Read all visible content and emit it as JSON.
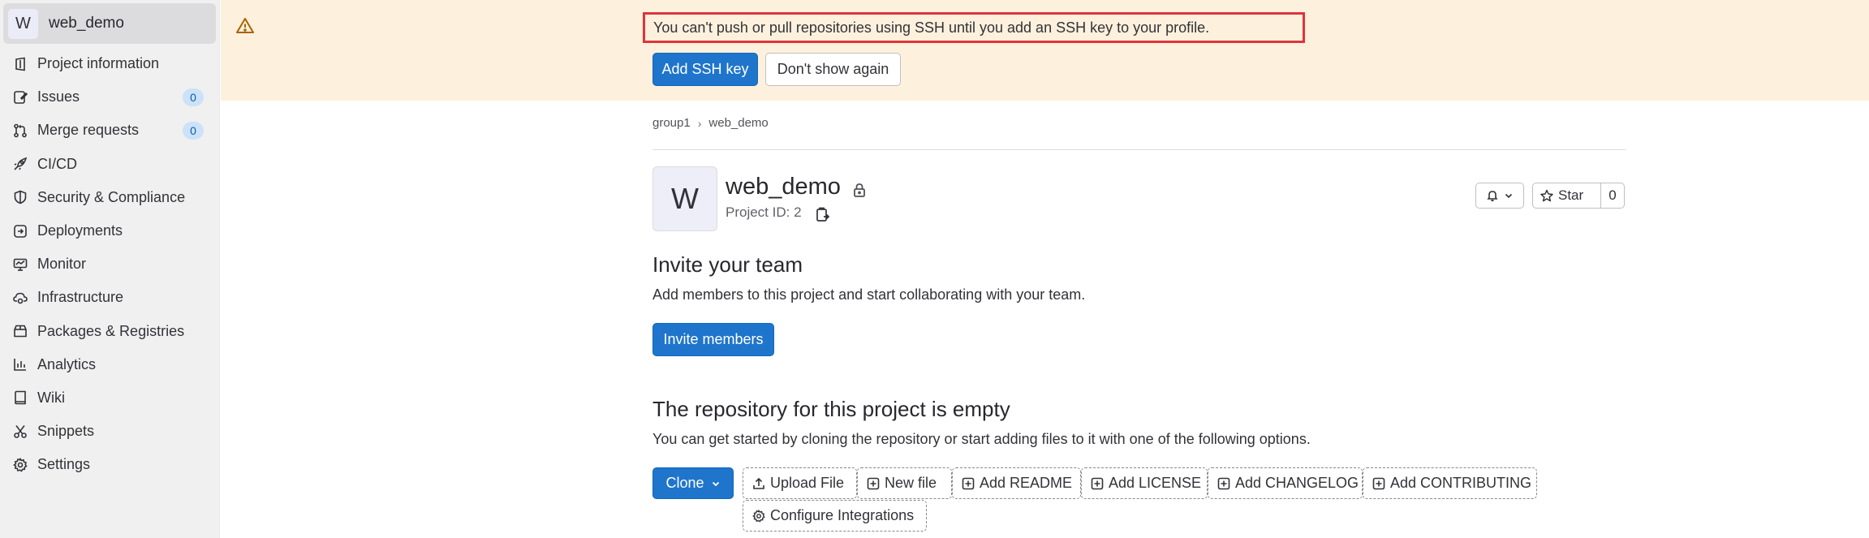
{
  "sidebar": {
    "project_avatar": "W",
    "project_name": "web_demo",
    "items": [
      {
        "label": "Project information",
        "icon": "project-icon"
      },
      {
        "label": "Issues",
        "icon": "issues-icon",
        "badge": "0"
      },
      {
        "label": "Merge requests",
        "icon": "merge-request-icon",
        "badge": "0"
      },
      {
        "label": "CI/CD",
        "icon": "rocket-icon"
      },
      {
        "label": "Security & Compliance",
        "icon": "shield-icon"
      },
      {
        "label": "Deployments",
        "icon": "deployments-icon"
      },
      {
        "label": "Monitor",
        "icon": "monitor-icon"
      },
      {
        "label": "Infrastructure",
        "icon": "cloud-gear-icon"
      },
      {
        "label": "Packages & Registries",
        "icon": "package-icon"
      },
      {
        "label": "Analytics",
        "icon": "chart-icon"
      },
      {
        "label": "Wiki",
        "icon": "book-icon"
      },
      {
        "label": "Snippets",
        "icon": "snippet-icon"
      },
      {
        "label": "Settings",
        "icon": "gear-icon"
      }
    ]
  },
  "banner": {
    "message": "You can't push or pull repositories using SSH until you add an SSH key to your profile.",
    "add_ssh_key": "Add SSH key",
    "dont_show_again": "Don't show again"
  },
  "breadcrumb": {
    "group": "group1",
    "project": "web_demo"
  },
  "project": {
    "avatar": "W",
    "name": "web_demo",
    "id_text": "Project ID: 2",
    "star_label": "Star",
    "star_count": "0"
  },
  "invite": {
    "heading": "Invite your team",
    "text": "Add members to this project and start collaborating with your team.",
    "button": "Invite members"
  },
  "empty_repo": {
    "heading": "The repository for this project is empty",
    "text": "You can get started by cloning the repository or start adding files to it with one of the following options.",
    "clone": "Clone",
    "actions": [
      "Upload File",
      "New file",
      "Add README",
      "Add LICENSE",
      "Add CHANGELOG",
      "Add CONTRIBUTING"
    ],
    "configure": "Configure Integrations"
  },
  "colors": {
    "primary": "#1f75cb",
    "banner_bg": "#fdf1dd",
    "highlight_border": "#e0333b",
    "sidebar_bg": "#f0f0f0",
    "badge_bg": "#cbe2f9"
  }
}
